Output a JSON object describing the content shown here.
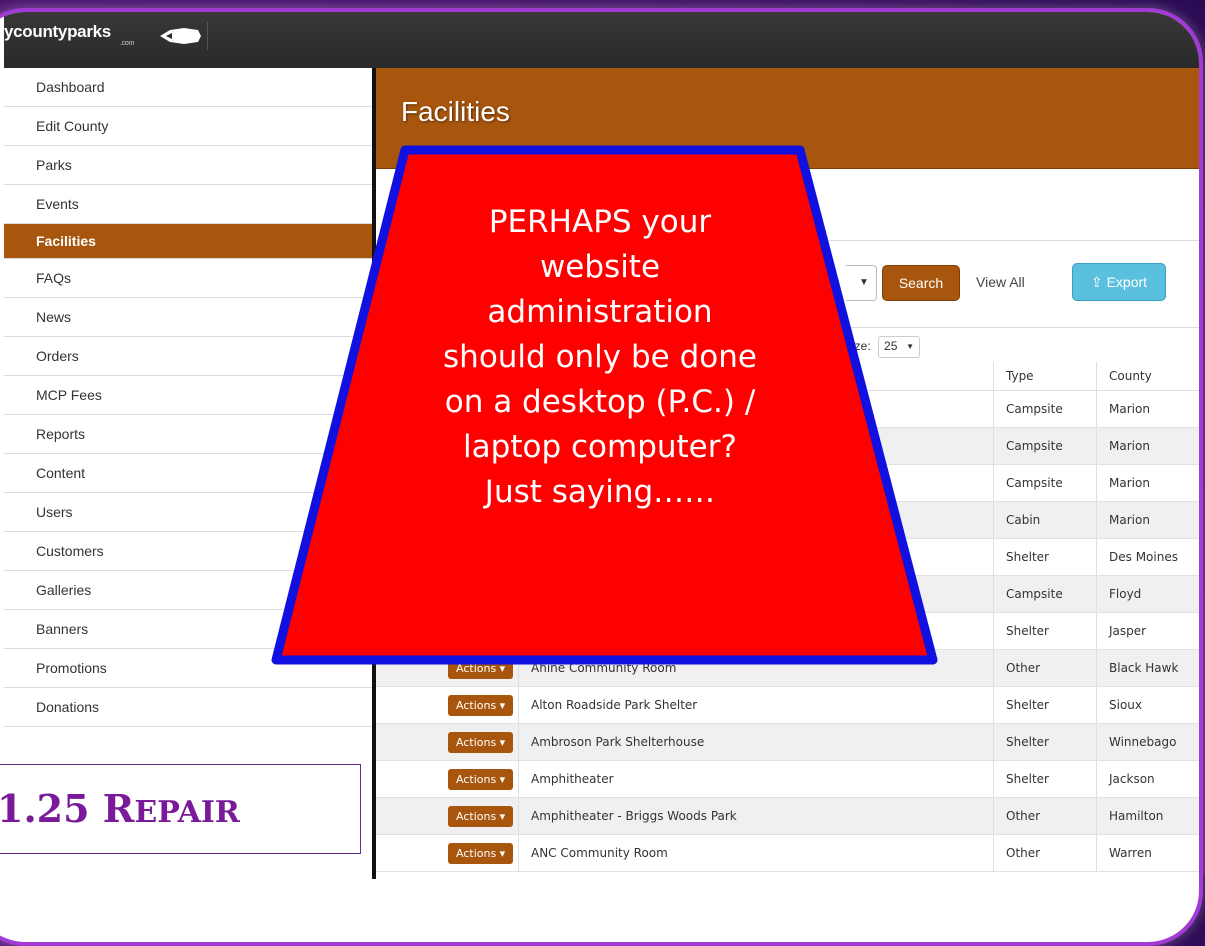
{
  "brand": {
    "name": "ycountyparks",
    "sub": ".com"
  },
  "sidebar": {
    "items": [
      {
        "label": "Dashboard"
      },
      {
        "label": "Edit County"
      },
      {
        "label": "Parks"
      },
      {
        "label": "Events"
      },
      {
        "label": "Facilities",
        "active": true
      },
      {
        "label": "FAQs"
      },
      {
        "label": "News"
      },
      {
        "label": "Orders"
      },
      {
        "label": "MCP Fees"
      },
      {
        "label": "Reports"
      },
      {
        "label": "Content"
      },
      {
        "label": "Users"
      },
      {
        "label": "Customers"
      },
      {
        "label": "Galleries"
      },
      {
        "label": "Banners"
      },
      {
        "label": "Promotions"
      },
      {
        "label": "Donations"
      }
    ]
  },
  "header": {
    "title": "Facilities"
  },
  "toolbar": {
    "search_label": "Search",
    "view_all_label": "View All",
    "export_label": "Export"
  },
  "page_size": {
    "label": "ize:",
    "value": "25"
  },
  "table": {
    "columns": [
      "Type",
      "County"
    ],
    "action_label": "Actions",
    "rows": [
      {
        "name": "",
        "type": "Campsite",
        "county": "Marion"
      },
      {
        "name": "",
        "type": "Campsite",
        "county": "Marion"
      },
      {
        "name": "",
        "type": "Campsite",
        "county": "Marion"
      },
      {
        "name": "",
        "type": "Cabin",
        "county": "Marion"
      },
      {
        "name": "",
        "type": "Shelter",
        "county": "Des Moines"
      },
      {
        "name": "",
        "type": "Campsite",
        "county": "Floyd"
      },
      {
        "name": "",
        "type": "Shelter",
        "county": "Jasper"
      },
      {
        "name": "Ahine Community Room",
        "type": "Other",
        "county": "Black Hawk"
      },
      {
        "name": "Alton Roadside Park Shelter",
        "type": "Shelter",
        "county": "Sioux"
      },
      {
        "name": "Ambroson Park Shelterhouse",
        "type": "Shelter",
        "county": "Winnebago"
      },
      {
        "name": "Amphitheater",
        "type": "Shelter",
        "county": "Jackson"
      },
      {
        "name": "Amphitheater - Briggs Woods Park",
        "type": "Other",
        "county": "Hamilton"
      },
      {
        "name": "ANC Community Room",
        "type": "Other",
        "county": "Warren"
      }
    ]
  },
  "overlay": {
    "lines": [
      "PERHAPS your",
      "website",
      "administration",
      "should only be done",
      "on a desktop (P.C.) /",
      "laptop computer?",
      "Just saying……"
    ],
    "fill": "#ff0000",
    "stroke": "#1010e0"
  },
  "caption": {
    "big": "1.25 R",
    "small": "EPAIR"
  },
  "colors": {
    "accent": "#a8560e",
    "export": "#5bc0de",
    "frame": "#a23bd6"
  }
}
